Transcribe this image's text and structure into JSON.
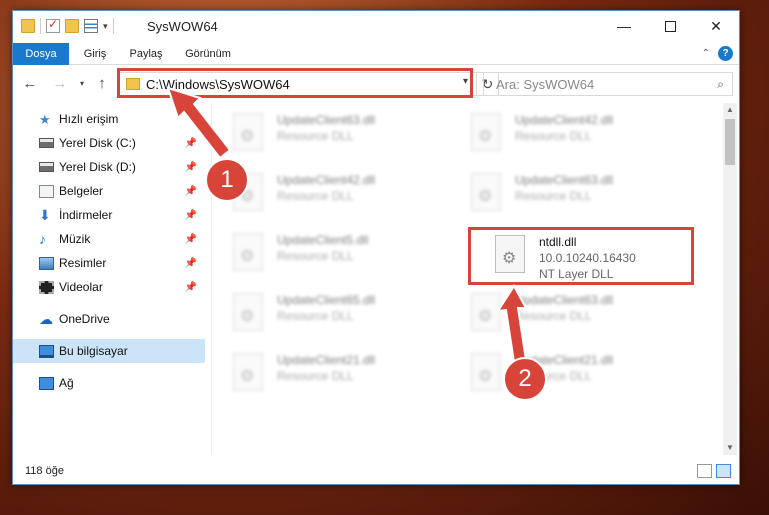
{
  "window": {
    "title": "SysWOW64"
  },
  "ribbon": {
    "tabs": [
      "Dosya",
      "Giriş",
      "Paylaş",
      "Görünüm"
    ]
  },
  "address": {
    "path": "C:\\Windows\\SysWOW64"
  },
  "search": {
    "placeholder": "Ara: SysWOW64"
  },
  "nav": {
    "items": [
      {
        "label": "Hızlı erişim",
        "icon": "star-icon"
      },
      {
        "label": "Yerel Disk (C:)",
        "icon": "drive-icon"
      },
      {
        "label": "Yerel Disk (D:)",
        "icon": "drive-icon"
      },
      {
        "label": "Belgeler",
        "icon": "document-icon"
      },
      {
        "label": "İndirmeler",
        "icon": "download-icon"
      },
      {
        "label": "Müzik",
        "icon": "music-icon"
      },
      {
        "label": "Resimler",
        "icon": "pictures-icon"
      },
      {
        "label": "Videolar",
        "icon": "video-icon"
      },
      {
        "label": "OneDrive",
        "icon": "cloud-icon"
      },
      {
        "label": "Bu bilgisayar",
        "icon": "computer-icon"
      },
      {
        "label": "Ağ",
        "icon": "network-icon"
      }
    ]
  },
  "files": {
    "left": [
      {
        "name": "UpdateClient63.dll",
        "type": "Resource DLL"
      },
      {
        "name": "UpdateClient42.dll",
        "type": "Resource DLL"
      },
      {
        "name": "UpdateClient5.dll",
        "type": "Resource DLL"
      },
      {
        "name": "UpdateClient65.dll",
        "type": "Resource DLL"
      },
      {
        "name": "UpdateClient21.dll",
        "type": "Resource DLL"
      }
    ],
    "right": [
      {
        "name": "UpdateClient42.dll",
        "type": "Resource DLL"
      },
      {
        "name": "UpdateClient63.dll",
        "type": "Resource DLL"
      },
      {
        "name": "UpdateClient63.dll",
        "type": "Resource DLL"
      },
      {
        "name": "UpdateClient21.dll",
        "type": "Resource DLL"
      }
    ],
    "highlighted": {
      "name": "ntdll.dll",
      "version": "10.0.10240.16430",
      "description": "NT Layer DLL"
    }
  },
  "status": {
    "count": "118 öğe"
  },
  "annotations": {
    "step1": "1",
    "step2": "2",
    "color": "#d9443a"
  }
}
